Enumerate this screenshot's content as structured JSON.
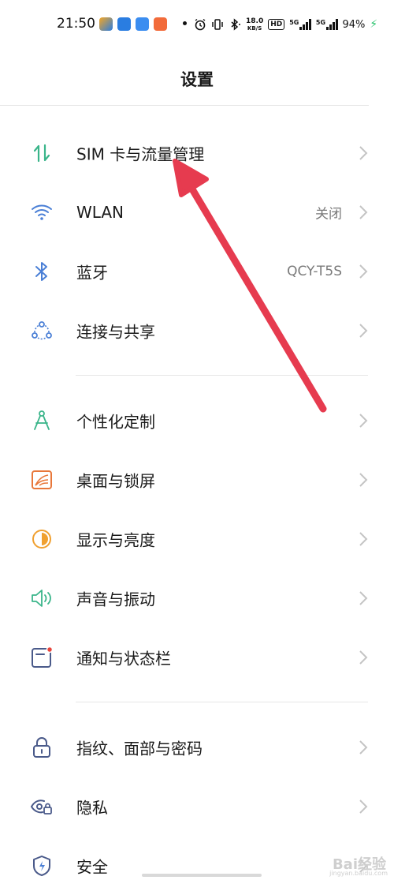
{
  "status_bar": {
    "time": "21:50",
    "network_speed_value": "18.0",
    "network_speed_unit": "KB/S",
    "hd_badge": "HD",
    "signal1_label": "5G",
    "signal2_label": "5G",
    "battery": "94%",
    "icons": [
      "app-icon-1",
      "app-icon-2",
      "app-icon-3",
      "app-icon-4",
      "alarm-icon",
      "vibrate-icon",
      "bluetooth-icon",
      "charging-icon"
    ]
  },
  "header": {
    "title": "设置"
  },
  "settings": {
    "items": [
      {
        "label": "SIM 卡与流量管理",
        "value": "",
        "icon": "sim-data-icon"
      },
      {
        "label": "WLAN",
        "value": "关闭",
        "icon": "wifi-icon"
      },
      {
        "label": "蓝牙",
        "value": "QCY-T5S",
        "icon": "bluetooth-icon"
      },
      {
        "label": "连接与共享",
        "value": "",
        "icon": "share-icon"
      },
      {
        "label": "个性化定制",
        "value": "",
        "icon": "compass-icon"
      },
      {
        "label": "桌面与锁屏",
        "value": "",
        "icon": "wallpaper-icon"
      },
      {
        "label": "显示与亮度",
        "value": "",
        "icon": "brightness-icon"
      },
      {
        "label": "声音与振动",
        "value": "",
        "icon": "speaker-icon"
      },
      {
        "label": "通知与状态栏",
        "value": "",
        "icon": "notification-icon"
      },
      {
        "label": "指纹、面部与密码",
        "value": "",
        "icon": "lock-icon"
      },
      {
        "label": "隐私",
        "value": "",
        "icon": "privacy-eye-icon"
      },
      {
        "label": "安全",
        "value": "",
        "icon": "shield-icon"
      }
    ]
  },
  "watermark": {
    "text": "Bai经验",
    "sub": "jingyan.baidu.com"
  },
  "colors": {
    "accent_green": "#3ab58a",
    "wifi_blue": "#4a7fd6",
    "orange": "#e8773a",
    "arrow_red": "#e63b4f"
  }
}
